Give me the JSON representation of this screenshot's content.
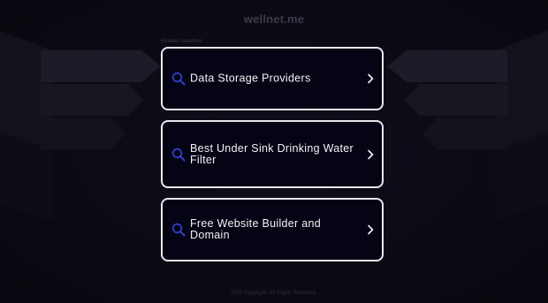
{
  "header": {
    "domain": "wellnet.me"
  },
  "related": {
    "label": "Related searches",
    "items": [
      {
        "label": "Data Storage Providers"
      },
      {
        "label": "Best Under Sink Drinking Water Filter"
      },
      {
        "label": "Free Website Builder and Domain"
      }
    ]
  },
  "footer": {
    "text": "2025 Copyright. All Rights Reserved."
  },
  "colors": {
    "background": "#0b0b14",
    "card_background": "#040414",
    "card_border": "#e8e8ee",
    "search_icon": "#2f3fc9",
    "text": "#f2f2f6"
  }
}
